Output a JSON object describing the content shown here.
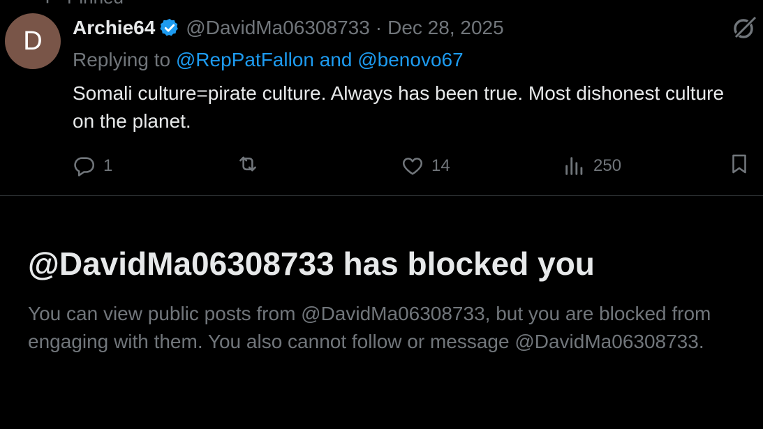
{
  "pinned": {
    "label": "Pinned"
  },
  "tweet": {
    "avatar_letter": "D",
    "avatar_color": "#795548",
    "display_name": "Archie64",
    "handle": "@DavidMa06308733",
    "separator": "·",
    "date": "Dec 28, 2025",
    "reply_prefix": "Replying to",
    "reply_mention_1": "@RepPatFallon",
    "reply_and": "and",
    "reply_mention_2": "@benovo67",
    "text": "Somali culture=pirate culture. Always has been true. Most dishonest culture on the planet.",
    "actions": {
      "reply_count": "1",
      "repost_count": "",
      "like_count": "14",
      "views_count": "250"
    },
    "icons": {
      "reply": "reply-icon",
      "repost": "repost-icon",
      "like": "heart-icon",
      "views": "views-icon",
      "bookmark": "bookmark-icon",
      "grok": "grok-icon",
      "verified": "verified-badge-icon"
    }
  },
  "blocked": {
    "title": "@DavidMa06308733 has blocked you",
    "description": "You can view public posts from @DavidMa06308733, but you are blocked from engaging with them. You also cannot follow or message @DavidMa06308733."
  },
  "colors": {
    "background": "#000000",
    "text_primary": "#e7e9ea",
    "text_secondary": "#71767b",
    "accent": "#1d9bf0",
    "divider": "#2f3336"
  }
}
